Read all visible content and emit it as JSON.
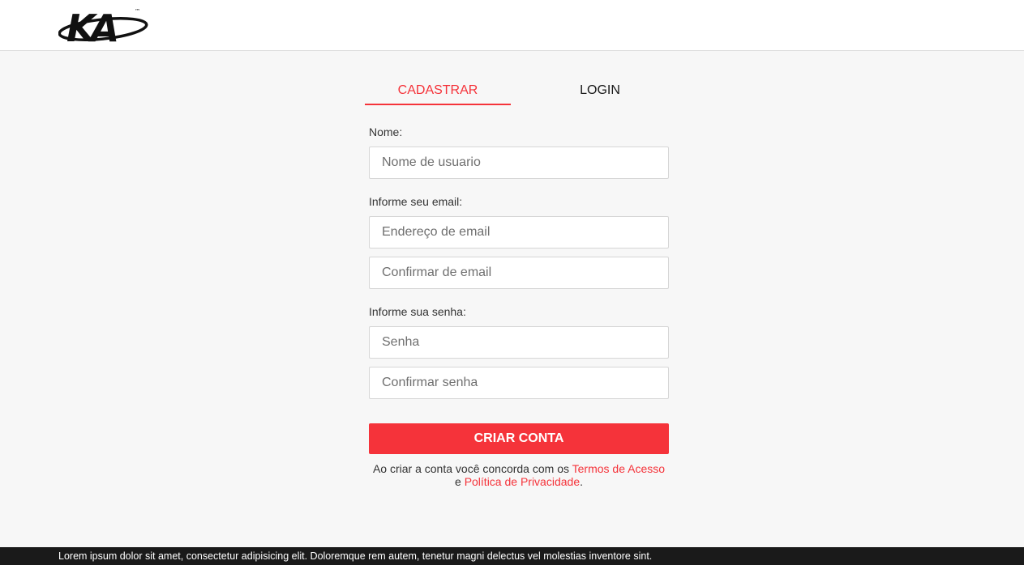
{
  "header": {
    "logo_text": "KA",
    "logo_tm": "™"
  },
  "tabs": {
    "register": "CADASTRAR",
    "login": "LOGIN"
  },
  "form": {
    "name_label": "Nome:",
    "username_placeholder": "Nome de usuario",
    "email_label": "Informe seu email:",
    "email_placeholder": "Endereço de email",
    "email_confirm_placeholder": "Confirmar de email",
    "password_label": "Informe sua senha:",
    "password_placeholder": "Senha",
    "password_confirm_placeholder": "Confirmar senha",
    "submit_label": "CRIAR CONTA"
  },
  "terms": {
    "prefix": "Ao criar a conta você concorda com os ",
    "terms_link": "Termos de Acesso",
    "middle": " e ",
    "privacy_link": "Política de Privacidade",
    "suffix": "."
  },
  "footer": {
    "text": "Lorem ipsum dolor sit amet, consectetur adipisicing elit. Doloremque rem autem, tenetur magni delectus vel molestias inventore sint."
  },
  "colors": {
    "accent": "#f5333a",
    "footer_bg": "#1a1a1a",
    "page_bg": "#f7f7f7"
  }
}
